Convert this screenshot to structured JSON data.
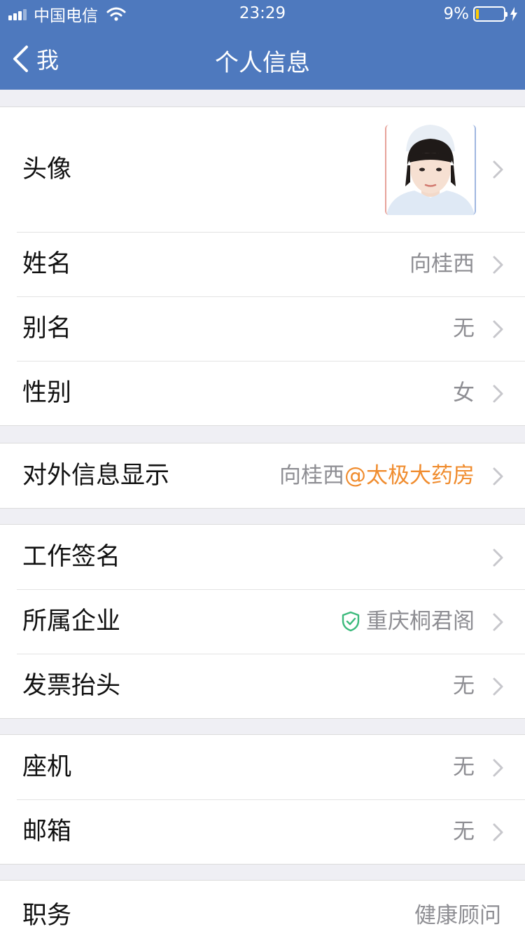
{
  "status_bar": {
    "carrier": "中国电信",
    "time": "23:29",
    "battery_percent": "9%",
    "battery_level": 0.09,
    "battery_color": "#ffcc00"
  },
  "nav": {
    "back_label": "我",
    "title": "个人信息",
    "bar_color": "#4e79be"
  },
  "profile": {
    "avatar_label": "头像",
    "name_label": "姓名",
    "name_value": "向桂西",
    "alias_label": "别名",
    "alias_value": "无",
    "gender_label": "性别",
    "gender_value": "女"
  },
  "external": {
    "label": "对外信息显示",
    "value_name": "向桂西",
    "value_org": "@太极大药房",
    "org_color": "#f08c2e"
  },
  "work": {
    "signature_label": "工作签名",
    "company_label": "所属企业",
    "company_value": "重庆桐君阁",
    "invoice_label": "发票抬头",
    "invoice_value": "无"
  },
  "contact": {
    "phone_label": "座机",
    "phone_value": "无",
    "email_label": "邮箱",
    "email_value": "无"
  },
  "job": {
    "title_label": "职务",
    "title_value": "健康顾问"
  },
  "icons": [
    "signal-icon",
    "wifi-icon",
    "battery-icon",
    "charging-icon",
    "back-chevron-icon",
    "chevron-right-icon",
    "verified-shield-icon"
  ]
}
